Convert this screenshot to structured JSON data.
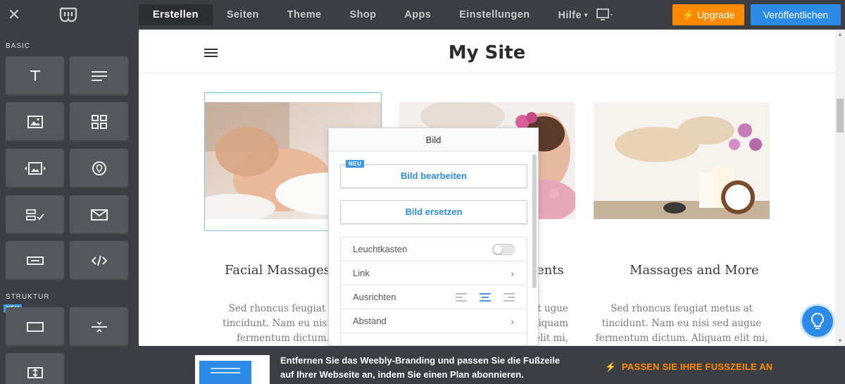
{
  "topbar": {
    "close_icon": "close-icon",
    "logo": "weebly-logo",
    "nav": [
      {
        "label": "Erstellen",
        "active": true
      },
      {
        "label": "Seiten"
      },
      {
        "label": "Theme"
      },
      {
        "label": "Shop"
      },
      {
        "label": "Apps"
      },
      {
        "label": "Einstellungen"
      },
      {
        "label": "Hilfe",
        "caret": "▾"
      }
    ],
    "device_icon": "desktop-icon",
    "upgrade_label": "Upgrade",
    "publish_label": "Veröffentlichen",
    "colors": {
      "upgrade": "#ff8a00",
      "publish": "#2b8be6"
    }
  },
  "sidebar": {
    "section_basic": "BASIC",
    "section_structure": "STRUKTUR",
    "neu_badge": "NEU",
    "tiles": [
      {
        "icon": "title-icon"
      },
      {
        "icon": "text-icon"
      },
      {
        "icon": "image-icon"
      },
      {
        "icon": "gallery-icon"
      },
      {
        "icon": "slideshow-icon"
      },
      {
        "icon": "map-icon"
      },
      {
        "icon": "contact-form-icon"
      },
      {
        "icon": "newsletter-icon"
      },
      {
        "icon": "button-icon"
      },
      {
        "icon": "embed-code-icon"
      },
      {
        "icon": "section-icon"
      },
      {
        "icon": "divider-icon"
      },
      {
        "icon": "spacer-icon"
      }
    ]
  },
  "site": {
    "title": "My Site",
    "columns": [
      {
        "title": "Facial Massages and",
        "body": "Sed rhoncus feugiat m tincidunt. Nam eu nisi se fermentum dictum. Aliquam elit mi,"
      },
      {
        "title": "ments",
        "body": "s at ugue Aliquam elit mi,"
      },
      {
        "title": "Massages and More",
        "body": "Sed rhoncus feugiat metus at tincidunt. Nam eu nisi sed augue fermentum dictum. Aliquam elit mi,"
      }
    ]
  },
  "popup": {
    "title": "Bild",
    "neu_badge": "NEU",
    "edit_label": "Bild bearbeiten",
    "replace_label": "Bild ersetzen",
    "rows": {
      "lightbox": "Leuchtkasten",
      "link": "Link",
      "align": "Ausrichten",
      "spacing": "Abstand"
    },
    "lightbox_enabled": false,
    "align_selected": "center"
  },
  "footer": {
    "text": "Entfernen Sie das Weebly-Branding und passen Sie die Fußzeile auf Ihrer Webseite an, indem Sie einen Plan abonnieren.",
    "cta": "PASSEN SIE IHRE FUSSZEILE AN",
    "cta_icon": "lightning-icon"
  },
  "help_icon": "lightbulb-icon"
}
